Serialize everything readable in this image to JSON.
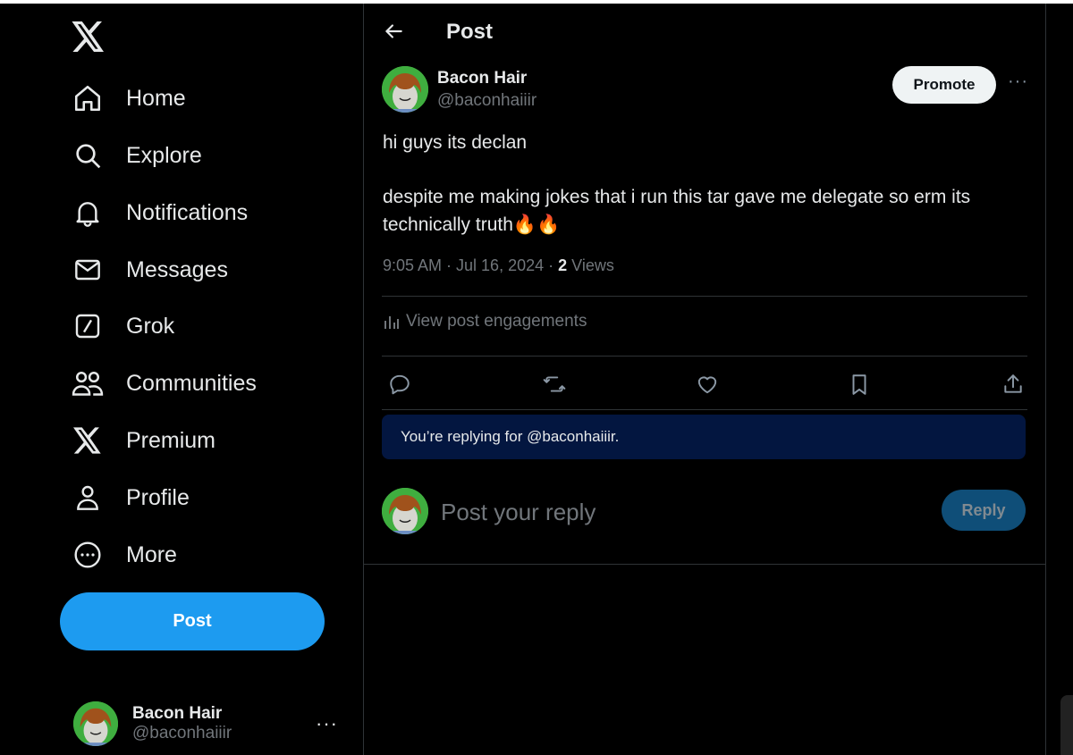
{
  "nav": {
    "items": [
      {
        "label": "Home",
        "icon": "home-icon"
      },
      {
        "label": "Explore",
        "icon": "search-icon"
      },
      {
        "label": "Notifications",
        "icon": "bell-icon"
      },
      {
        "label": "Messages",
        "icon": "envelope-icon"
      },
      {
        "label": "Grok",
        "icon": "grok-icon"
      },
      {
        "label": "Communities",
        "icon": "people-icon"
      },
      {
        "label": "Premium",
        "icon": "x-logo-icon"
      },
      {
        "label": "Profile",
        "icon": "person-icon"
      },
      {
        "label": "More",
        "icon": "more-circle-icon"
      }
    ],
    "post_button": "Post"
  },
  "account": {
    "name": "Bacon Hair",
    "handle": "@baconhaiiir",
    "more": "···"
  },
  "header": {
    "title": "Post"
  },
  "tweet": {
    "author_name": "Bacon Hair",
    "author_handle": "@baconhaiiir",
    "promote_label": "Promote",
    "more": "···",
    "text_line1": "hi guys its declan",
    "text_line2": "despite me making jokes that i run this tar gave me delegate so erm its technically truth🔥🔥",
    "time": "9:05 AM · Jul 16, 2024 · ",
    "views_count": "2",
    "views_label": " Views",
    "engagements_label": "View post engagements"
  },
  "reply": {
    "banner": "You’re replying for @baconhaiiir.",
    "placeholder": "Post your reply",
    "button": "Reply"
  },
  "colors": {
    "accent": "#1d9bf0",
    "background": "#000000",
    "banner": "#031640",
    "muted_text": "#71767b"
  }
}
